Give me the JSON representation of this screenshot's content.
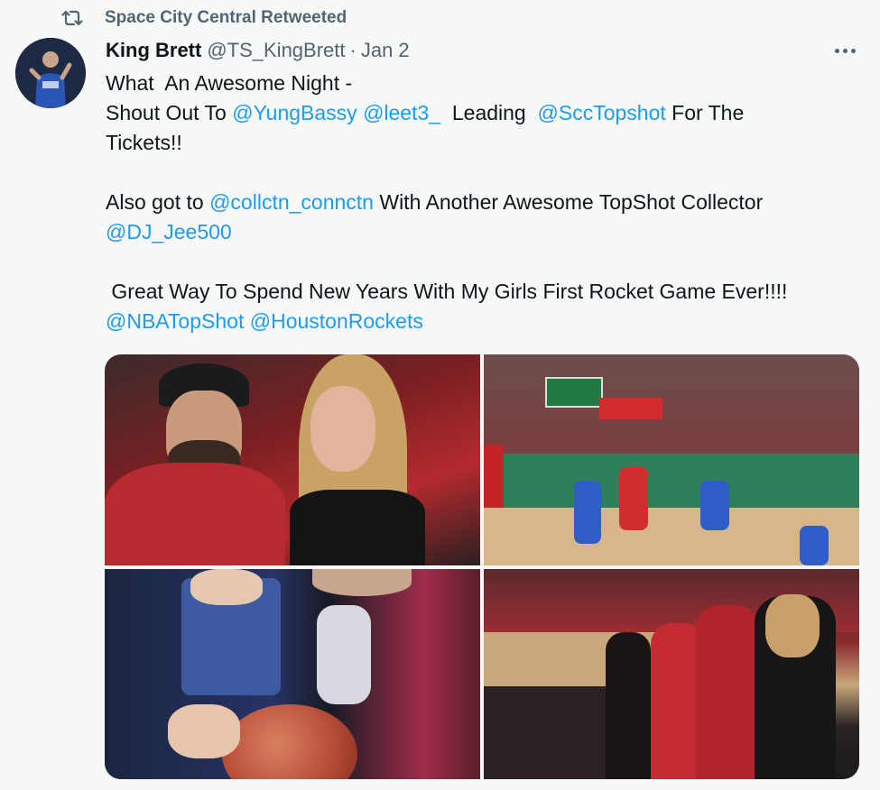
{
  "retweet": {
    "label": "Space City Central Retweeted"
  },
  "author": {
    "name": "King Brett",
    "handle": "@TS_KingBrett",
    "separator": "·",
    "date": "Jan 2"
  },
  "tweet": {
    "lines": [
      [
        {
          "t": "What  An Awesome Night -"
        }
      ],
      [
        {
          "t": "Shout Out To "
        },
        {
          "t": "@YungBassy",
          "m": true
        },
        {
          "t": " "
        },
        {
          "t": "@leet3_",
          "m": true
        },
        {
          "t": "  Leading  "
        },
        {
          "t": "@SccTopshot",
          "m": true
        },
        {
          "t": " For The"
        }
      ],
      [
        {
          "t": "Tickets!!"
        }
      ],
      [
        {
          "t": ""
        }
      ],
      [
        {
          "t": "Also got to "
        },
        {
          "t": "@collctn_connctn",
          "m": true
        },
        {
          "t": " With Another Awesome TopShot Collector"
        }
      ],
      [
        {
          "t": "@DJ_Jee500",
          "m": true
        }
      ],
      [
        {
          "t": ""
        }
      ],
      [
        {
          "t": " Great Way To Spend New Years With My Girls First Rocket Game Ever!!!!"
        }
      ],
      [
        {
          "t": "@NBATopShot",
          "m": true
        },
        {
          "t": " "
        },
        {
          "t": "@HoustonRockets",
          "m": true
        }
      ]
    ]
  },
  "media": {
    "photos": [
      {
        "name": "photo-couple-selfie"
      },
      {
        "name": "photo-game-action"
      },
      {
        "name": "photo-autograph-basketball"
      },
      {
        "name": "photo-group-arena"
      }
    ]
  },
  "icons": {
    "retweet": "retweet-icon",
    "more": "more-options-icon"
  },
  "colors": {
    "mention": "#1d9bf0",
    "secondary_text": "#536471",
    "primary_text": "#0f1419",
    "background": "#f7f9f9"
  }
}
